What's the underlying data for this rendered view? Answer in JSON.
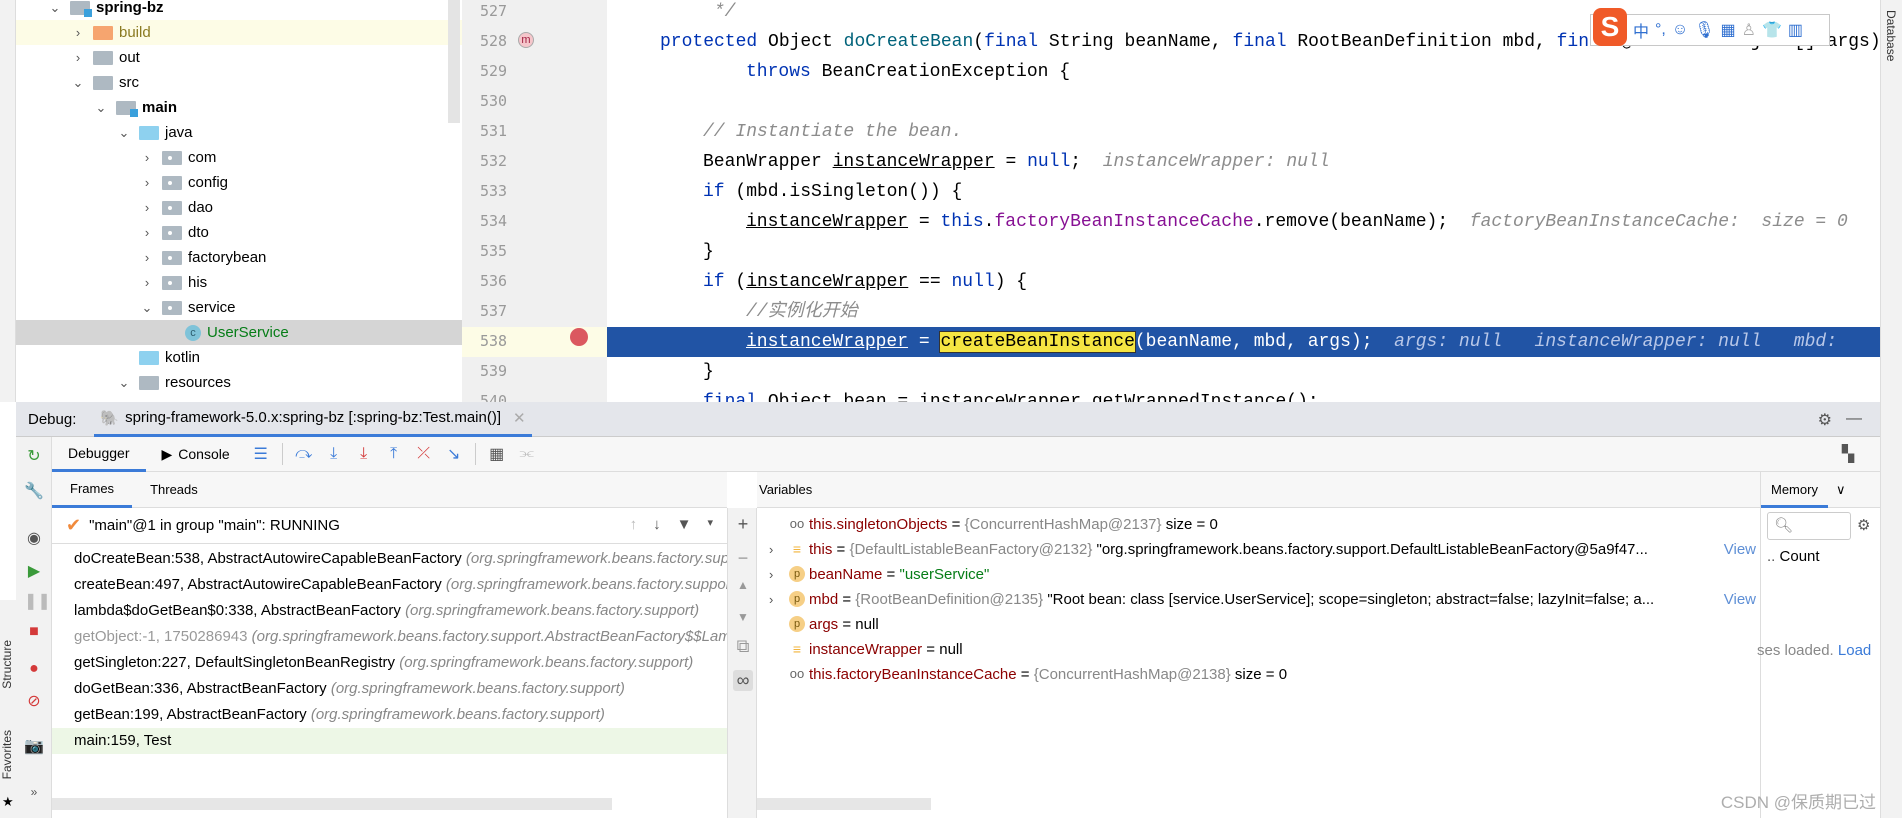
{
  "project_tree": {
    "items": [
      {
        "label": "spring-bz",
        "depth": 0,
        "chevron": "down",
        "icon": "module-folder",
        "bold": true
      },
      {
        "label": "build",
        "depth": 1,
        "chevron": "right",
        "icon": "orange-folder",
        "highlight": true
      },
      {
        "label": "out",
        "depth": 1,
        "chevron": "right",
        "icon": "folder"
      },
      {
        "label": "src",
        "depth": 1,
        "chevron": "down",
        "icon": "folder"
      },
      {
        "label": "main",
        "depth": 2,
        "chevron": "down",
        "icon": "module-folder",
        "bold": true
      },
      {
        "label": "java",
        "depth": 3,
        "chevron": "down",
        "icon": "source-folder"
      },
      {
        "label": "com",
        "depth": 4,
        "chevron": "right",
        "icon": "package"
      },
      {
        "label": "config",
        "depth": 4,
        "chevron": "right",
        "icon": "package"
      },
      {
        "label": "dao",
        "depth": 4,
        "chevron": "right",
        "icon": "package"
      },
      {
        "label": "dto",
        "depth": 4,
        "chevron": "right",
        "icon": "package"
      },
      {
        "label": "factorybean",
        "depth": 4,
        "chevron": "right",
        "icon": "package"
      },
      {
        "label": "his",
        "depth": 4,
        "chevron": "right",
        "icon": "package"
      },
      {
        "label": "service",
        "depth": 4,
        "chevron": "down",
        "icon": "package"
      },
      {
        "label": "UserService",
        "depth": 5,
        "chevron": "",
        "icon": "class",
        "selected": true,
        "color": "#067d17"
      },
      {
        "label": "kotlin",
        "depth": 3,
        "chevron": "",
        "icon": "source-folder"
      },
      {
        "label": "resources",
        "depth": 3,
        "chevron": "down",
        "icon": "resources-folder"
      }
    ]
  },
  "editor": {
    "current_line": "538",
    "lines": [
      {
        "num": "527",
        "indent": 1,
        "tokens": [
          {
            "t": " */",
            "c": "cm"
          }
        ]
      },
      {
        "num": "528",
        "indent": 0,
        "tokens": [
          {
            "t": "protected ",
            "c": "kw"
          },
          {
            "t": "Object "
          },
          {
            "t": "doCreateBean",
            "c": "fn"
          },
          {
            "t": "("
          },
          {
            "t": "final ",
            "c": "kw"
          },
          {
            "t": "String beanName, "
          },
          {
            "t": "final ",
            "c": "kw"
          },
          {
            "t": "RootBeanDefinition mbd, "
          },
          {
            "t": "final ",
            "c": "kw"
          },
          {
            "t": "@Nullable Object[] args)"
          }
        ]
      },
      {
        "num": "529",
        "indent": 2,
        "tokens": [
          {
            "t": "throws ",
            "c": "kw"
          },
          {
            "t": "BeanCreationException {"
          }
        ]
      },
      {
        "num": "530",
        "indent": 0,
        "tokens": []
      },
      {
        "num": "531",
        "indent": 1,
        "tokens": [
          {
            "t": "// Instantiate the bean.",
            "c": "cm"
          }
        ]
      },
      {
        "num": "532",
        "indent": 1,
        "tokens": [
          {
            "t": "BeanWrapper "
          },
          {
            "t": "instanceWrapper",
            "c": "und"
          },
          {
            "t": " = "
          },
          {
            "t": "null",
            "c": "kw"
          },
          {
            "t": ";"
          }
        ],
        "hint": "instanceWrapper: null"
      },
      {
        "num": "533",
        "indent": 1,
        "tokens": [
          {
            "t": "if ",
            "c": "kw"
          },
          {
            "t": "(mbd.isSingleton()) {"
          }
        ]
      },
      {
        "num": "534",
        "indent": 2,
        "tokens": [
          {
            "t": "instanceWrapper",
            "c": "und"
          },
          {
            "t": " = "
          },
          {
            "t": "this",
            "c": "kw"
          },
          {
            "t": "."
          },
          {
            "t": "factoryBeanInstanceCache",
            "c": "fld"
          },
          {
            "t": ".remove(beanName);"
          }
        ],
        "hint": "factoryBeanInstanceCache:  size = 0"
      },
      {
        "num": "535",
        "indent": 1,
        "tokens": [
          {
            "t": "}"
          }
        ]
      },
      {
        "num": "536",
        "indent": 1,
        "tokens": [
          {
            "t": "if ",
            "c": "kw"
          },
          {
            "t": "("
          },
          {
            "t": "instanceWrapper",
            "c": "und"
          },
          {
            "t": " == "
          },
          {
            "t": "null",
            "c": "kw"
          },
          {
            "t": ") {"
          }
        ]
      },
      {
        "num": "537",
        "indent": 2,
        "tokens": [
          {
            "t": "//实例化开始",
            "c": "cm"
          }
        ]
      },
      {
        "num": "538",
        "indent": 2,
        "tokens": [
          {
            "t": "instanceWrapper",
            "c": "und"
          },
          {
            "t": " = "
          },
          {
            "t": "createBeanInstance",
            "c": "srch"
          },
          {
            "t": "(beanName, mbd, args);"
          }
        ],
        "hint": "args: null   instanceWrapper: null   mbd:"
      },
      {
        "num": "539",
        "indent": 1,
        "tokens": [
          {
            "t": "}"
          }
        ]
      },
      {
        "num": "540",
        "indent": 1,
        "tokens": [
          {
            "t": "final ",
            "c": "kw"
          },
          {
            "t": "Object bean = instanceWrapper.getWrappedInstance();"
          }
        ]
      }
    ]
  },
  "right_stripe": {
    "database_label": "Database"
  },
  "ime_toolbar": {
    "logo": "S",
    "mode": "中",
    "punct": "°,"
  },
  "debug": {
    "label": "Debug:",
    "session_tab": "spring-framework-5.0.x:spring-bz [:spring-bz:Test.main()]",
    "tabs": {
      "debugger": "Debugger",
      "console": "Console"
    },
    "frames_tabs": {
      "frames": "Frames",
      "threads": "Threads"
    },
    "variables_label": "Variables",
    "thread": "\"main\"@1 in group \"main\": RUNNING",
    "frames": [
      {
        "method": "doCreateBean:538, AbstractAutowireCapableBeanFactory",
        "pkg": "(org.springframework.beans.factory.support)",
        "state": "selected"
      },
      {
        "method": "createBean:497, AbstractAutowireCapableBeanFactory",
        "pkg": "(org.springframework.beans.factory.support)"
      },
      {
        "method": "lambda$doGetBean$0:338, AbstractBeanFactory",
        "pkg": "(org.springframework.beans.factory.support)"
      },
      {
        "method": "getObject:-1, 1750286943",
        "pkg": "(org.springframework.beans.factory.support.AbstractBeanFactory$$Lambda)",
        "state": "dim"
      },
      {
        "method": "getSingleton:227, DefaultSingletonBeanRegistry",
        "pkg": "(org.springframework.beans.factory.support)"
      },
      {
        "method": "doGetBean:336, AbstractBeanFactory",
        "pkg": "(org.springframework.beans.factory.support)"
      },
      {
        "method": "getBean:199, AbstractBeanFactory",
        "pkg": "(org.springframework.beans.factory.support)"
      },
      {
        "method": "main:159, Test",
        "pkg": "",
        "state": "main"
      }
    ],
    "variables": [
      {
        "icon": "watch",
        "expand": false,
        "name": "this.singletonObjects",
        "type": "{ConcurrentHashMap@2137}",
        "value": "size = 0"
      },
      {
        "icon": "field",
        "expand": true,
        "name": "this",
        "type": "{DefaultListableBeanFactory@2132}",
        "value": "\"org.springframework.beans.factory.support.DefaultListableBeanFactory@5a9f47...",
        "view": "View"
      },
      {
        "icon": "param",
        "expand": true,
        "name": "beanName",
        "type": "",
        "value": "\"userService\"",
        "string": true
      },
      {
        "icon": "param",
        "expand": true,
        "name": "mbd",
        "type": "{RootBeanDefinition@2135}",
        "value": "\"Root bean: class [service.UserService]; scope=singleton; abstract=false; lazyInit=false; a...",
        "view": "View"
      },
      {
        "icon": "param",
        "expand": false,
        "name": "args",
        "type": "",
        "value": "null"
      },
      {
        "icon": "field",
        "expand": false,
        "name": "instanceWrapper",
        "type": "",
        "value": "null"
      },
      {
        "icon": "watch",
        "expand": false,
        "name": "this.factoryBeanInstanceCache",
        "type": "{ConcurrentHashMap@2138}",
        "value": "size = 0"
      }
    ],
    "memory": {
      "tab": "Memory",
      "column": "Count",
      "status": "ses loaded.",
      "load_link": "Load"
    }
  },
  "side_labels": {
    "structure": "Structure",
    "favorites": "Favorites"
  },
  "watermark": "CSDN @保质期已过"
}
